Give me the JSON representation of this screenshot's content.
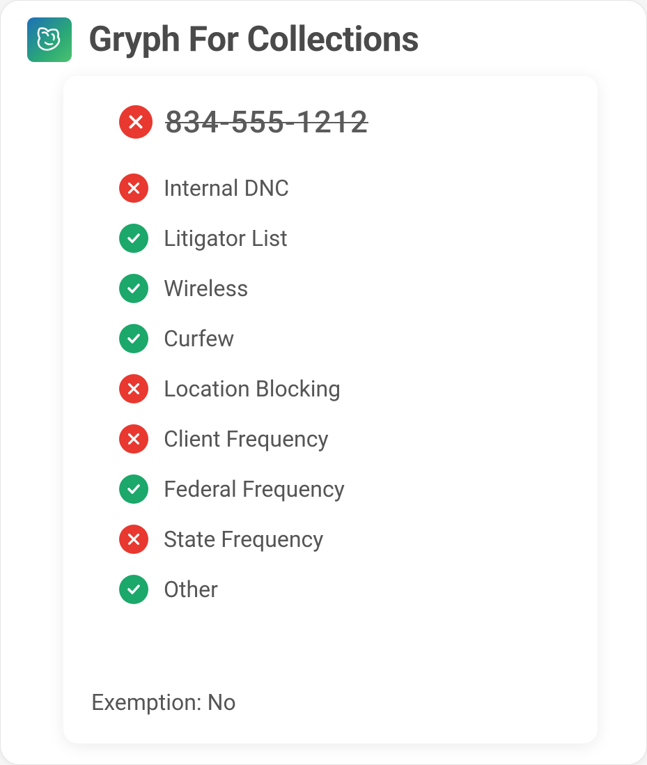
{
  "header": {
    "title": "Gryph For Collections"
  },
  "phone": {
    "number": "834-555-1212",
    "blocked": true
  },
  "checks": [
    {
      "label": "Internal DNC",
      "status": "fail"
    },
    {
      "label": "Litigator List",
      "status": "pass"
    },
    {
      "label": "Wireless",
      "status": "pass"
    },
    {
      "label": "Curfew",
      "status": "pass"
    },
    {
      "label": "Location Blocking",
      "status": "fail"
    },
    {
      "label": "Client Frequency",
      "status": "fail"
    },
    {
      "label": "Federal Frequency",
      "status": "pass"
    },
    {
      "label": "State Frequency",
      "status": "fail"
    },
    {
      "label": "Other",
      "status": "pass"
    }
  ],
  "exemption": {
    "label": "Exemption:",
    "value": "No"
  },
  "colors": {
    "fail": "#e8382f",
    "pass": "#1ba86a"
  }
}
